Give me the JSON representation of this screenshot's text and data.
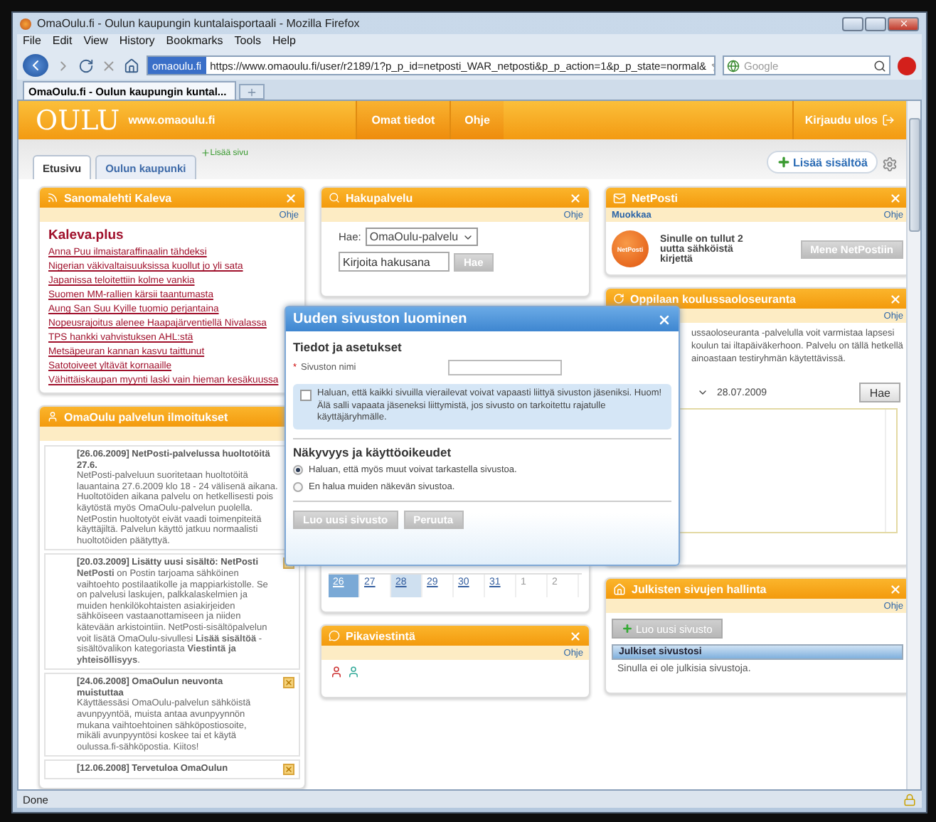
{
  "window": {
    "title": "OmaOulu.fi - Oulun kaupungin kuntalaisportaali - Mozilla Firefox"
  },
  "menu": [
    "File",
    "Edit",
    "View",
    "History",
    "Bookmarks",
    "Tools",
    "Help"
  ],
  "navigation": {
    "site_badge": "omaoulu.fi",
    "url": "https://www.omaoulu.fi/user/r2189/1?p_p_id=netposti_WAR_netposti&p_p_action=1&p_p_state=normal&",
    "search_placeholder": "Google"
  },
  "browser_tabs": [
    {
      "label": "OmaOulu.fi - Oulun kaupungin kuntal...",
      "selected": true
    }
  ],
  "site_header": {
    "logo": "OULU",
    "domain": "www.omaoulu.fi",
    "nav": [
      "Omat tiedot",
      "Ohje"
    ],
    "logout": "Kirjaudu ulos"
  },
  "page_tabs": [
    {
      "label": "Etusivu",
      "selected": true
    },
    {
      "label": "Oulun kaupunki",
      "selected": false
    }
  ],
  "add_page": "Lisää sivu",
  "add_content": "Lisää sisältöä",
  "news": {
    "title": "Sanomalehti Kaleva",
    "help": "Ohje",
    "source": "Kaleva.plus",
    "links": [
      "Anna Puu ilmaistaraffinaalin tähdeksi",
      "Nigerian väkivaltaisuuksissa kuollut jo yli sata",
      "Japanissa teloitettiin kolme vankia",
      "Suomen MM-rallien kärsii taantumasta",
      "Aung San Suu Kyille tuomio perjantaina",
      "Nopeusrajoitus alenee Haapajärventiellä Nivalassa",
      "TPS hankki vahvistuksen AHL:stä",
      "Metsäpeuran kannan kasvu taittunut",
      "Satotoiveet yltävät kornaaille",
      "Vähittäiskaupan myynti laski vain hieman kesäkuussa"
    ]
  },
  "notices": {
    "title": "OmaOulu palvelun ilmoitukset",
    "items": [
      {
        "title": "[26.06.2009] NetPosti-palvelussa huoltotöitä 27.6.",
        "body": "NetPosti-palveluun suoritetaan huoltotöitä lauantaina 27.6.2009 klo 18 - 24 välisenä aikana. Huoltotöiden aikana palvelu on hetkellisesti pois käytöstä myös OmaOulu-palvelun puolella. NetPostin huoltotyöt eivät vaadi toimenpiteitä käyttäjiltä. Palvelun käyttö jatkuu normaalisti huoltotöiden päätyttyä."
      },
      {
        "title": "[20.03.2009] Lisätty uusi sisältö: NetPosti",
        "body": "**NetPosti** on Postin tarjoama sähköinen vaihtoehto postilaatikolle ja mappiarkistolle. Se on palvelusi laskujen, palkkalaskelmien ja muiden henkilökohtaisten asiakirjeiden sähköiseen vastaanottamiseen ja niiden kätevään arkistointiin. NetPosti-sisältöpalvelun voit lisätä OmaOulu-sivullesi **Lisää sisältöä** -sisältövalikon kategoriasta **Viestintä ja yhteisöllisyys**.",
        "close": true
      },
      {
        "title": "[24.06.2008] OmaOulun neuvonta muistuttaa",
        "body": "Käyttäessäsi OmaOulu-palvelun sähköistä avunpyyntöä, muista antaa avunpyynnön mukana vaihtoehtoinen sähköpostiosoite, mikäli avunpyyntösi koskee tai et käytä oulussa.fi-sähköpostia. Kiitos!",
        "close": true
      },
      {
        "title": "[12.06.2008] Tervetuloa OmaOulun",
        "close": true
      }
    ]
  },
  "search": {
    "title": "Hakupalvelu",
    "help": "Ohje",
    "label": "Hae:",
    "scope": "OmaOulu-palvelu",
    "placeholder": "Kirjoita hakusana",
    "button": "Hae"
  },
  "calendar": {
    "days": [
      {
        "label": "26",
        "selected": true,
        "today": false,
        "other_month": false
      },
      {
        "label": "27",
        "selected": false,
        "today": false,
        "other_month": false
      },
      {
        "label": "28",
        "selected": false,
        "today": true,
        "other_month": false
      },
      {
        "label": "29",
        "selected": false,
        "today": false,
        "other_month": false
      },
      {
        "label": "30",
        "selected": false,
        "today": false,
        "other_month": false
      },
      {
        "label": "31",
        "selected": false,
        "today": false,
        "other_month": false
      },
      {
        "label": "1",
        "selected": false,
        "today": false,
        "other_month": true
      },
      {
        "label": "2",
        "selected": false,
        "today": false,
        "other_month": true
      }
    ]
  },
  "messaging": {
    "title": "Pikaviestintä",
    "help": "Ohje"
  },
  "netposti": {
    "title": "NetPosti",
    "edit": "Muokkaa",
    "help": "Ohje",
    "logo": "NetPosti",
    "message": "Sinulle on tullut 2 uutta sähköistä kirjettä",
    "button": "Mene NetPostiin"
  },
  "attendance": {
    "title": "Oppilaan koulussaoloseuranta",
    "help": "Ohje",
    "lines": [
      "ussaoloseuranta -palvelulla voit varmistaa lapsesi",
      "koulun tai iltapäiväkerhoon. Palvelu on tällä hetkellä",
      "ainoastaan testiryhmän käytettävissä."
    ],
    "date": "28.07.2009",
    "button": "Hae"
  },
  "public_sites": {
    "title": "Julkisten sivujen hallinta",
    "help": "Ohje",
    "button": "Luo uusi sivusto",
    "column": "Julkiset sivustosi",
    "empty": "Sinulla ei ole julkisia sivustoja."
  },
  "dialog": {
    "title": "Uuden sivuston luominen",
    "section1": "Tiedot ja asetukset",
    "name_label": "Sivuston nimi",
    "required_mark": "*",
    "open_join": {
      "label": "Haluan, että kaikki sivuilla vierailevat voivat vapaasti liittyä sivuston jäseniksi. Huom! Älä salli vapaata jäseneksi liittymistä, jos sivusto on tarkoitettu rajatulle käyttäjäryhmälle.",
      "checked": false
    },
    "section2": "Näkyvyys ja käyttöoikeudet",
    "visibility": [
      {
        "label": "Haluan, että myös muut voivat tarkastella sivustoa.",
        "selected": true
      },
      {
        "label": "En halua muiden näkevän sivustoa.",
        "selected": false
      }
    ],
    "buttons": [
      "Luo uusi sivusto",
      "Peruuta"
    ]
  },
  "status_bar": {
    "text": "Done"
  }
}
